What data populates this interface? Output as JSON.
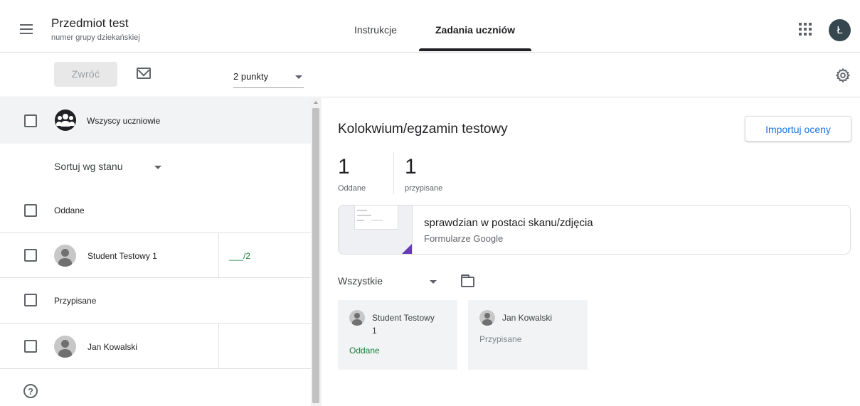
{
  "header": {
    "course_title": "Przedmiot test",
    "course_subtitle": "numer grupy dziekańskiej",
    "tabs": [
      {
        "label": "Instrukcje",
        "active": false
      },
      {
        "label": "Zadania uczniów",
        "active": true
      }
    ],
    "avatar_letter": "Ł",
    "avatar_color": "#37474f"
  },
  "toolbar": {
    "return_label": "Zwróć",
    "points_value": "2 punkty"
  },
  "left_panel": {
    "all_students_label": "Wszyscy uczniowie",
    "sort_label": "Sortuj wg stanu",
    "groups": [
      {
        "label": "Oddane",
        "students": [
          {
            "name": "Student Testowy 1",
            "grade": "___/2"
          }
        ]
      },
      {
        "label": "Przypisane",
        "students": [
          {
            "name": "Jan Kowalski",
            "grade": ""
          }
        ]
      }
    ]
  },
  "right_panel": {
    "assignment_title": "Kolokwium/egzamin testowy",
    "import_label": "Importuj oceny",
    "stats": [
      {
        "value": "1",
        "label": "Oddane"
      },
      {
        "value": "1",
        "label": "przypisane"
      }
    ],
    "attachment": {
      "title": "sprawdzian w postaci skanu/zdjęcia",
      "subtitle": "Formularze Google",
      "accent_color": "#673ab7"
    },
    "filter_label": "Wszystkie",
    "student_cards": [
      {
        "name_line1": "Student Testowy",
        "name_line2": "1",
        "status": "Oddane",
        "status_color": "#188038"
      },
      {
        "name_line1": "Jan Kowalski",
        "name_line2": "",
        "status": "Przypisane",
        "status_color": "#80868b"
      }
    ]
  },
  "colors": {
    "accent_blue": "#1a73e8",
    "graded_green": "#188038"
  }
}
